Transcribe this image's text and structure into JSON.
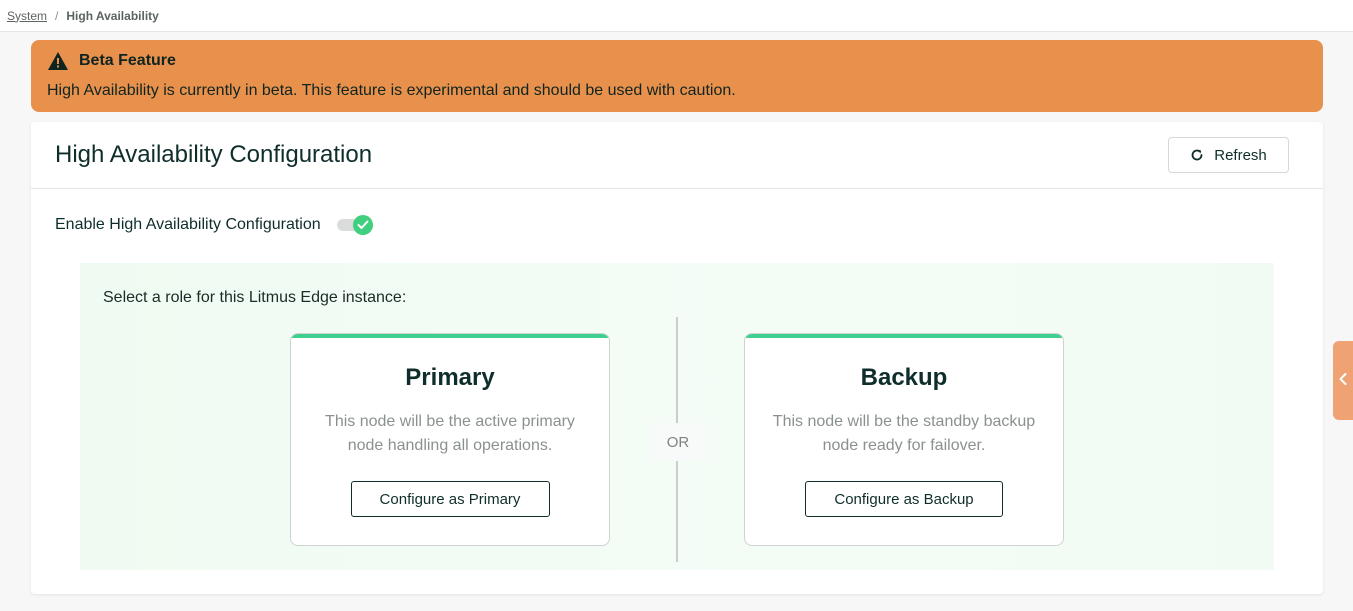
{
  "breadcrumb": {
    "parent": "System",
    "separator": "/",
    "current": "High Availability"
  },
  "beta_banner": {
    "title": "Beta Feature",
    "message": "High Availability is currently in beta. This feature is experimental and should be used with caution.",
    "icon": "warning-icon",
    "color": "#e8914d"
  },
  "config": {
    "title": "High Availability Configuration",
    "refresh_label": "Refresh",
    "toggle_label": "Enable High Availability Configuration",
    "toggle_enabled": true,
    "role_prompt": "Select a role for this Litmus Edge instance:",
    "or_label": "OR",
    "roles": [
      {
        "title": "Primary",
        "description": "This node will be the active primary node handling all operations.",
        "button_label": "Configure as Primary"
      },
      {
        "title": "Backup",
        "description": "This node will be the standby backup node ready for failover.",
        "button_label": "Configure as Backup"
      }
    ]
  },
  "colors": {
    "accent_green": "#3fcf8e",
    "text_dark": "#0f2e2b",
    "side_tab": "#efa273"
  }
}
